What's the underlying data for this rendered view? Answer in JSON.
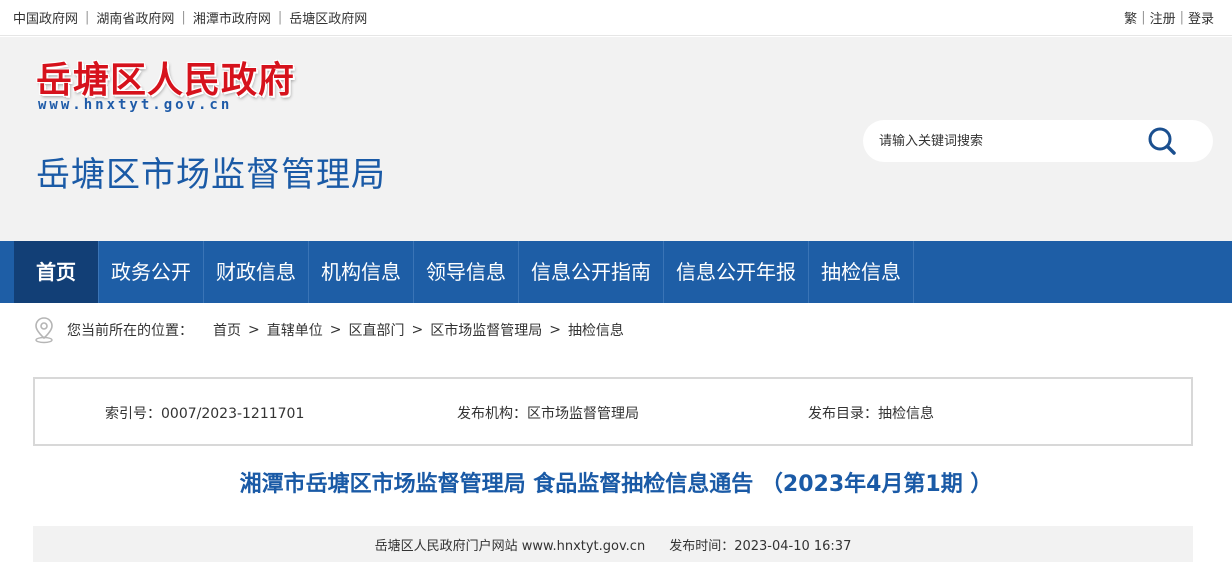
{
  "topbar": {
    "links": [
      "中国政府网",
      "湖南省政府网",
      "湘潭市政府网",
      "岳塘区政府网"
    ],
    "right": [
      "繁",
      "注册",
      "登录"
    ]
  },
  "header": {
    "logo_title": "岳塘区人民政府",
    "logo_url": "www.hnxtyt.gov.cn",
    "dept_name": "岳塘区市场监督管理局",
    "search_placeholder": "请输入关键词搜索"
  },
  "nav": {
    "items": [
      "首页",
      "政务公开",
      "财政信息",
      "机构信息",
      "领导信息",
      "信息公开指南",
      "信息公开年报",
      "抽检信息"
    ],
    "active_index": 0
  },
  "breadcrumb": {
    "label": "您当前所在的位置：",
    "items": [
      "首页",
      "直辖单位",
      "区直部门",
      "区市场监督管理局",
      "抽检信息"
    ]
  },
  "info": {
    "index_no": "索引号：0007/2023-1211701",
    "publisher": "发布机构：区市场监督管理局",
    "catalog": "发布目录：抽检信息"
  },
  "article": {
    "title": "湘潭市岳塘区市场监督管理局 食品监督抽检信息通告 （2023年4月第1期 ）",
    "source": "岳塘区人民政府门户网站 www.hnxtyt.gov.cn",
    "publish_time": "发布时间：2023-04-10 16:37"
  },
  "colors": {
    "nav_bg": "#1e5ea6",
    "nav_active": "#123f76",
    "logo_red": "#d6121c",
    "title_blue": "#1a5aa6"
  }
}
